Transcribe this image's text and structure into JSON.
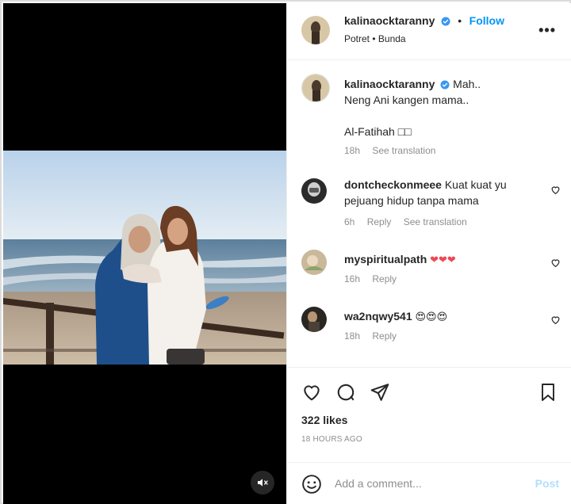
{
  "post": {
    "author": "kalinaocktaranny",
    "location": "Potret • Bunda",
    "follow_label": "Follow",
    "more_label": "•••"
  },
  "caption": {
    "username": "kalinaocktaranny",
    "line1": "Mah..",
    "line2": "Neng Ani kangen mama..",
    "line3": "Al-Fatihah □□",
    "time": "18h",
    "translate": "See translation"
  },
  "comments": [
    {
      "username": "dontcheckonmeee",
      "text": "Kuat kuat yu pejuang hidup tanpa mama",
      "time": "6h",
      "reply": "Reply",
      "translate": "See translation"
    },
    {
      "username": "myspiritualpath",
      "text": "❤❤❤",
      "time": "16h",
      "reply": "Reply"
    },
    {
      "username": "wa2nqwy541",
      "text": "😍😍😍",
      "time": "18h",
      "reply": "Reply"
    }
  ],
  "stats": {
    "likes": "322 likes",
    "ago": "18 HOURS AGO"
  },
  "composer": {
    "placeholder": "Add a comment...",
    "post_label": "Post"
  },
  "colors": {
    "accent": "#0095f6",
    "post_disabled": "#b2dffc",
    "muted": "#8e8e8e",
    "heart": "#ed4956"
  },
  "icons": [
    "mute-icon",
    "verified-icon",
    "more-icon",
    "like-icon",
    "comment-icon",
    "share-icon",
    "save-icon",
    "emoji-icon"
  ]
}
